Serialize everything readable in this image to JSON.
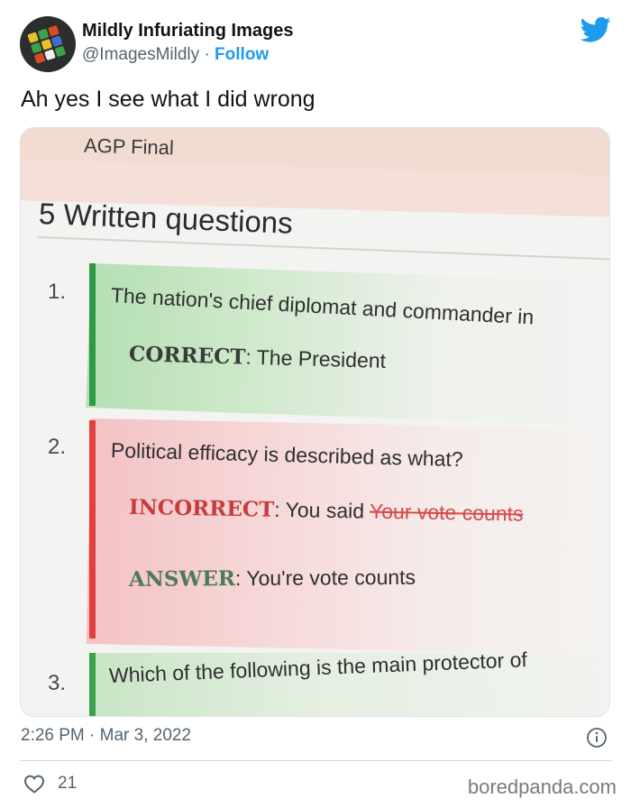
{
  "author": {
    "display_name": "Mildly Infuriating Images",
    "handle": "@ImagesMildly",
    "separator": "·",
    "follow_label": "Follow"
  },
  "tweet_text": "Ah yes I see what I did wrong",
  "photo": {
    "top_tab": "AGP Final",
    "heading": "5 Written questions",
    "questions": [
      {
        "number": "1.",
        "text": "The nation's chief diplomat and commander in",
        "result_label": "CORRECT",
        "result_sep": ":",
        "result_text": "The President"
      },
      {
        "number": "2.",
        "text": "Political efficacy is described as what?",
        "result_label": "INCORRECT",
        "result_sep": ":",
        "result_prefix": "You said",
        "result_struck": "Your vote counts",
        "answer_label": "ANSWER",
        "answer_sep": ":",
        "answer_text": "You're vote counts"
      },
      {
        "number": "3.",
        "text": "Which of the following is the main protector of"
      }
    ]
  },
  "footer": {
    "time": "2:26 PM",
    "separator": "·",
    "date": "Mar 3, 2022",
    "like_count": "21",
    "watermark": "boredpanda.com"
  },
  "icons": {
    "brand": "twitter-bird-icon",
    "info": "info-icon",
    "like": "heart-icon"
  },
  "colors": {
    "twitter_blue": "#1d9bf0",
    "secondary_text": "#536471",
    "correct_green": "#2f9a45",
    "incorrect_red": "#e23f3f"
  }
}
